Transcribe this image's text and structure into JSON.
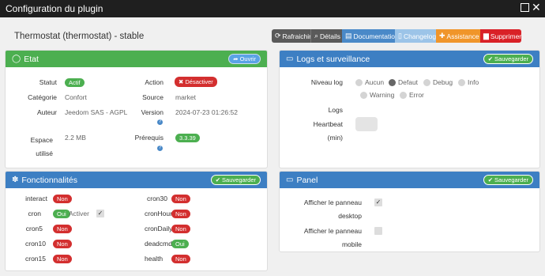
{
  "window": {
    "title": "Configuration du plugin"
  },
  "plugin_title": "Thermostat (thermostat) - stable",
  "actions": [
    {
      "label": "Rafraichir",
      "icon": "refresh-icon"
    },
    {
      "label": "Détails",
      "icon": "search-icon"
    },
    {
      "label": "Documentation",
      "icon": "book-icon"
    },
    {
      "label": "Changelog",
      "icon": "file-icon"
    },
    {
      "label": "Assistance",
      "icon": "ambulance-icon"
    },
    {
      "label": "Supprimer",
      "icon": "trash-icon"
    }
  ],
  "etat": {
    "title": "Etat",
    "open_label": "Ouvrir",
    "statut_label": "Statut",
    "statut_value": "Actif",
    "action_label": "Action",
    "action_value": "Désactiver",
    "categorie_label": "Catégorie",
    "categorie_value": "Confort",
    "source_label": "Source",
    "source_value": "market",
    "auteur_label": "Auteur",
    "auteur_value": "Jeedom SAS - AGPL",
    "version_label": "Version",
    "version_value": "2024-07-23 01:26:52",
    "espace_label_1": "Espace",
    "espace_label_2": "utilisé",
    "espace_value": "2.2 MB",
    "prerequis_label": "Prérequis",
    "prerequis_value": "3.3.39"
  },
  "logs": {
    "title": "Logs et surveillance",
    "save_label": "Sauvegarder",
    "niveau_label": "Niveau log",
    "levels": [
      "Aucun",
      "Defaut",
      "Debug",
      "Info",
      "Warning",
      "Error"
    ],
    "selected_level": "Defaut",
    "logs_label": "Logs",
    "heartbeat_label": "Heartbeat",
    "heartbeat_unit": "(min)"
  },
  "fonctionnalites": {
    "title": "Fonctionnalités",
    "save_label": "Sauvegarder",
    "left": [
      {
        "name": "interact",
        "value": "Non"
      },
      {
        "name": "cron",
        "value": "Oui",
        "extra": "Activer"
      },
      {
        "name": "cron5",
        "value": "Non"
      },
      {
        "name": "cron10",
        "value": "Non"
      },
      {
        "name": "cron15",
        "value": "Non"
      }
    ],
    "right": [
      {
        "name": "cron30",
        "value": "Non"
      },
      {
        "name": "cronHourly",
        "value": "Non"
      },
      {
        "name": "cronDaily",
        "value": "Non"
      },
      {
        "name": "deadcmd",
        "value": "Oui"
      },
      {
        "name": "health",
        "value": "Non"
      }
    ]
  },
  "panel": {
    "title": "Panel",
    "save_label": "Sauvegarder",
    "desktop_label_1": "Afficher le panneau",
    "desktop_label_2": "desktop",
    "desktop_checked": true,
    "mobile_label_1": "Afficher le panneau",
    "mobile_label_2": "mobile",
    "mobile_checked": false
  },
  "colors": {
    "green": "#4caf50",
    "blue": "#3d7fc3",
    "red": "#d32f2f",
    "orange": "#f0952a",
    "doc_blue": "#4a89c8"
  }
}
